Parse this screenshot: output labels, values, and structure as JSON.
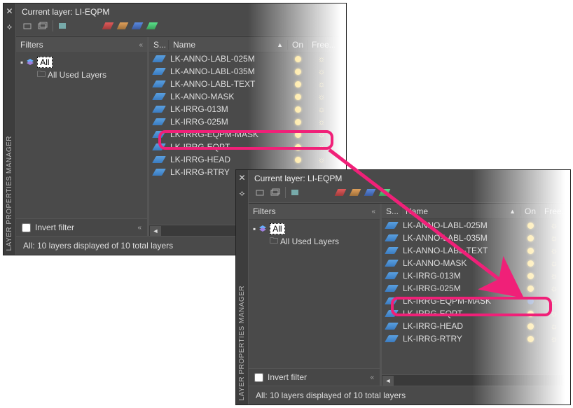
{
  "panel_title": "LAYER PROPERTIES MANAGER",
  "current_layer_prefix": "Current layer:",
  "current_layer": "LI-EQPM",
  "filters_header": "Filters",
  "filters": {
    "root": "All",
    "child": "All Used Layers"
  },
  "columns": {
    "s": "S...",
    "name": "Name",
    "on": "On",
    "freeze": "Free..."
  },
  "invert_label": "Invert filter",
  "status": "All: 10 layers displayed of 10 total layers",
  "layers": [
    {
      "name": "LK-ANNO-LABL-025M",
      "on": true
    },
    {
      "name": "LK-ANNO-LABL-035M",
      "on": true
    },
    {
      "name": "LK-ANNO-LABL-TEXT",
      "on": true
    },
    {
      "name": "LK-ANNO-MASK",
      "on": true
    },
    {
      "name": "LK-IRRG-013M",
      "on": true
    },
    {
      "name": "LK-IRRG-025M",
      "on": true
    },
    {
      "name": "LK-IRRG-EQPM-MASK",
      "on": true
    },
    {
      "name": "LK-IRRG-EQPT",
      "on": true
    },
    {
      "name": "LK-IRRG-HEAD",
      "on": true
    },
    {
      "name": "LK-IRRG-RTRY",
      "on": true
    }
  ],
  "layers_after": [
    {
      "name": "LK-ANNO-LABL-025M",
      "on": true
    },
    {
      "name": "LK-ANNO-LABL-035M",
      "on": true
    },
    {
      "name": "LK-ANNO-LABL-TEXT",
      "on": true
    },
    {
      "name": "LK-ANNO-MASK",
      "on": true
    },
    {
      "name": "LK-IRRG-013M",
      "on": true
    },
    {
      "name": "LK-IRRG-025M",
      "on": true
    },
    {
      "name": "LK-IRRG-EQPM-MASK",
      "on": false
    },
    {
      "name": "LK-IRRG-EQPT",
      "on": true
    },
    {
      "name": "LK-IRRG-HEAD",
      "on": true
    },
    {
      "name": "LK-IRRG-RTRY",
      "on": true
    }
  ],
  "highlight_index": 6,
  "toolbar_icons": [
    "new-filter-icon",
    "new-group-icon",
    "layer-states-icon",
    "layer-new-red",
    "layer-new-green",
    "layer-new-blue",
    "layer-new-teal"
  ],
  "accent": "#f02078"
}
